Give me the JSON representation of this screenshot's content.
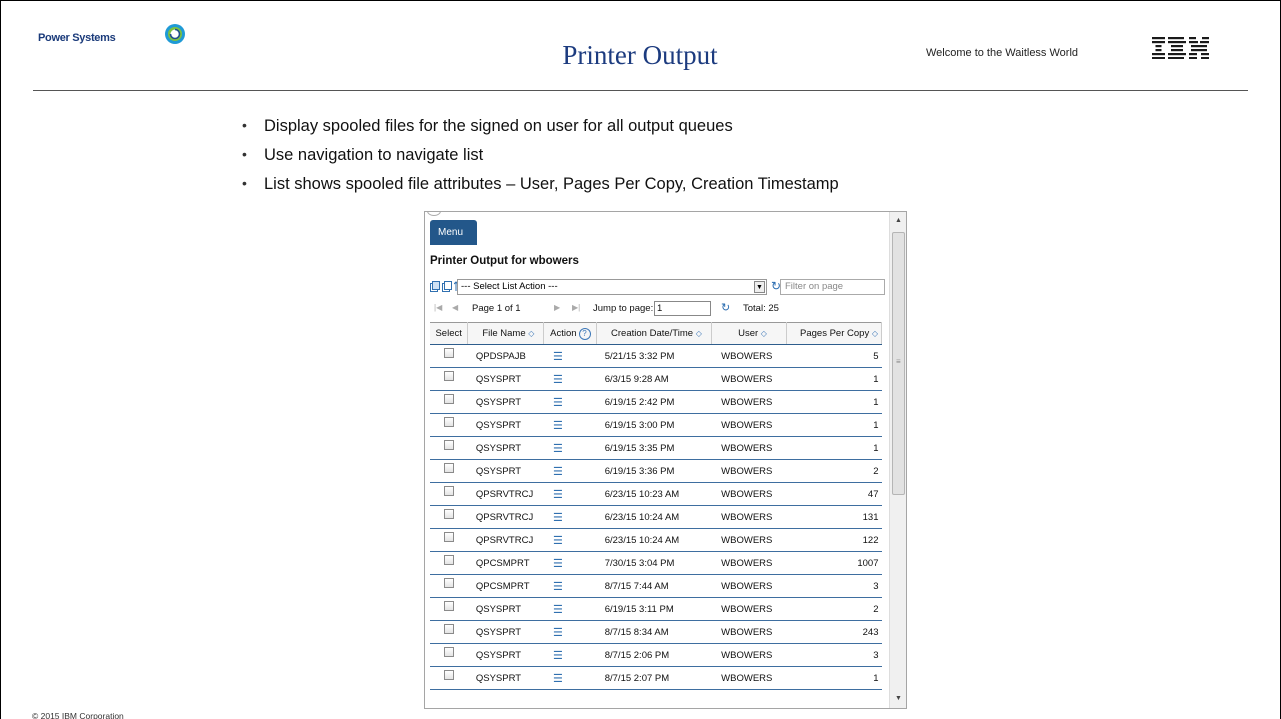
{
  "header": {
    "brand": "Power Systems",
    "title": "Printer Output",
    "tagline": "Welcome to the Waitless World"
  },
  "bullets": [
    "Display spooled files for the signed on user for all output queues",
    "Use navigation to navigate list",
    "List shows spooled file attributes – User, Pages Per Copy, Creation Timestamp"
  ],
  "panel": {
    "menu_label": "Menu",
    "heading": "Printer Output for wbowers",
    "select_value": "--- Select List Action ---",
    "filter_placeholder": "Filter on page",
    "pager": {
      "page_label": "Page 1 of 1",
      "jump_label": "Jump to page:",
      "jump_value": "1",
      "total_label": "Total: 25"
    },
    "columns": [
      "Select",
      "File Name",
      "Action",
      "Creation Date/Time",
      "User",
      "Pages Per Copy"
    ],
    "rows": [
      {
        "file": "QPDSPAJB",
        "date": "5/21/15 3:32 PM",
        "user": "WBOWERS",
        "pages": "5"
      },
      {
        "file": "QSYSPRT",
        "date": "6/3/15 9:28 AM",
        "user": "WBOWERS",
        "pages": "1"
      },
      {
        "file": "QSYSPRT",
        "date": "6/19/15 2:42 PM",
        "user": "WBOWERS",
        "pages": "1"
      },
      {
        "file": "QSYSPRT",
        "date": "6/19/15 3:00 PM",
        "user": "WBOWERS",
        "pages": "1"
      },
      {
        "file": "QSYSPRT",
        "date": "6/19/15 3:35 PM",
        "user": "WBOWERS",
        "pages": "1"
      },
      {
        "file": "QSYSPRT",
        "date": "6/19/15 3:36 PM",
        "user": "WBOWERS",
        "pages": "2"
      },
      {
        "file": "QPSRVTRCJ",
        "date": "6/23/15 10:23 AM",
        "user": "WBOWERS",
        "pages": "47"
      },
      {
        "file": "QPSRVTRCJ",
        "date": "6/23/15 10:24 AM",
        "user": "WBOWERS",
        "pages": "131"
      },
      {
        "file": "QPSRVTRCJ",
        "date": "6/23/15 10:24 AM",
        "user": "WBOWERS",
        "pages": "122"
      },
      {
        "file": "QPCSMPRT",
        "date": "7/30/15 3:04 PM",
        "user": "WBOWERS",
        "pages": "1007"
      },
      {
        "file": "QPCSMPRT",
        "date": "8/7/15 7:44 AM",
        "user": "WBOWERS",
        "pages": "3"
      },
      {
        "file": "QSYSPRT",
        "date": "6/19/15 3:11 PM",
        "user": "WBOWERS",
        "pages": "2"
      },
      {
        "file": "QSYSPRT",
        "date": "8/7/15 8:34 AM",
        "user": "WBOWERS",
        "pages": "243"
      },
      {
        "file": "QSYSPRT",
        "date": "8/7/15 2:06 PM",
        "user": "WBOWERS",
        "pages": "3"
      },
      {
        "file": "QSYSPRT",
        "date": "8/7/15 2:07 PM",
        "user": "WBOWERS",
        "pages": "1"
      }
    ]
  },
  "footer": {
    "copyright": "© 2015 IBM Corporation"
  },
  "colors": {
    "title_blue": "#1c3b7f",
    "menu_blue": "#23578a",
    "row_rule": "#3e6ea0"
  },
  "icons": {
    "brand": "power-systems-logo-icon",
    "ibm": "ibm-logo-icon",
    "action": "list-icon",
    "help": "help-icon",
    "refresh": "refresh-icon"
  }
}
